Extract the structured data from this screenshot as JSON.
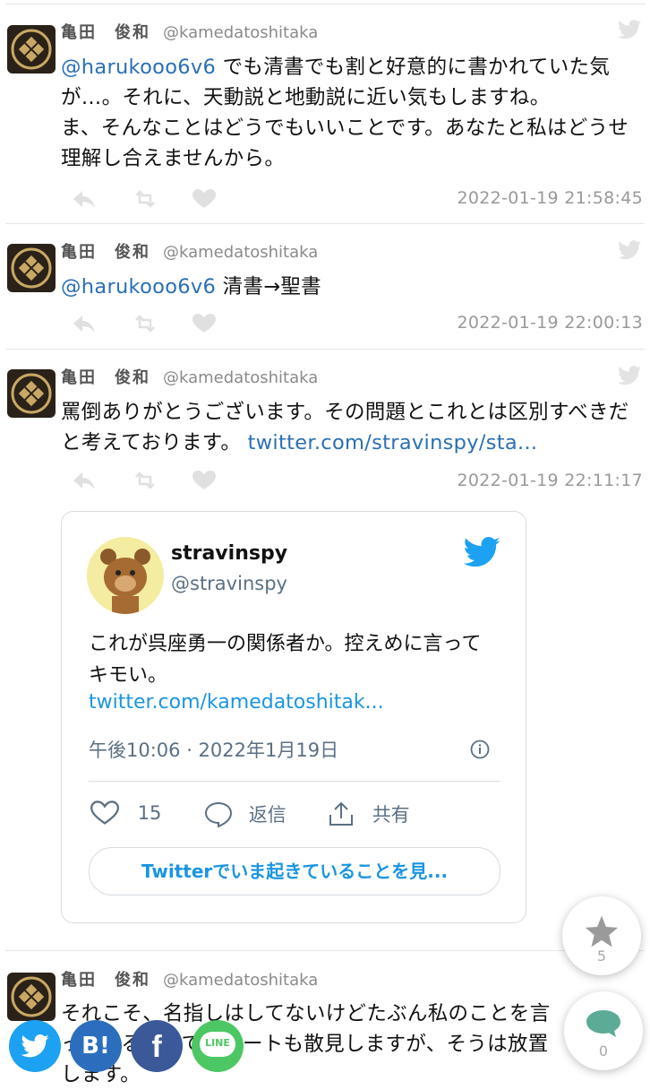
{
  "tweets": [
    {
      "name": "亀田　俊和",
      "handle": "@kamedatoshitaka",
      "mention": "@harukooo6v6",
      "text": " でも清書でも割と好意的に書かれていた気が…。それに、天動説と地動説に近い気もしますね。\nま、そんなことはどうでもいいことです。あなたと私はどうせ理解し合えませんから。",
      "timestamp": "2022-01-19 21:58:45"
    },
    {
      "name": "亀田　俊和",
      "handle": "@kamedatoshitaka",
      "mention": "@harukooo6v6",
      "text": " 清書→聖書",
      "timestamp": "2022-01-19 22:00:13"
    },
    {
      "name": "亀田　俊和",
      "handle": "@kamedatoshitaka",
      "text": "罵倒ありがとうございます。その問題とこれとは区別すべきだと考えております。 ",
      "link": "twitter.com/stravinspy/sta...",
      "timestamp": "2022-01-19 22:11:17"
    },
    {
      "name": "亀田　俊和",
      "handle": "@kamedatoshitaka",
      "text": "それこそ、名指しはしてないけどたぶん私のことを言っているなってツイートも散見しますが、そうは放置します。"
    }
  ],
  "embed": {
    "name": "stravinspy",
    "handle": "@stravinspy",
    "text": "これが呉座勇一の関係者か。控えめに言ってキモい。",
    "link": "twitter.com/kamedatoshitak...",
    "time": "午後10:06 · 2022年1月19日",
    "likes": "15",
    "reply_label": "返信",
    "share_label": "共有",
    "cta": "Twitterでいま起きていることを見..."
  },
  "fab": {
    "star_count": "5",
    "comment_count": "0"
  },
  "share_buttons": {
    "hatena": "B!",
    "facebook": "f",
    "line": "LINE"
  },
  "colors": {
    "link": "#2a6fb5",
    "twitter_blue": "#1da1f2",
    "hatena": "#2c6ebd",
    "facebook": "#3b5998",
    "line": "#4cc764"
  }
}
